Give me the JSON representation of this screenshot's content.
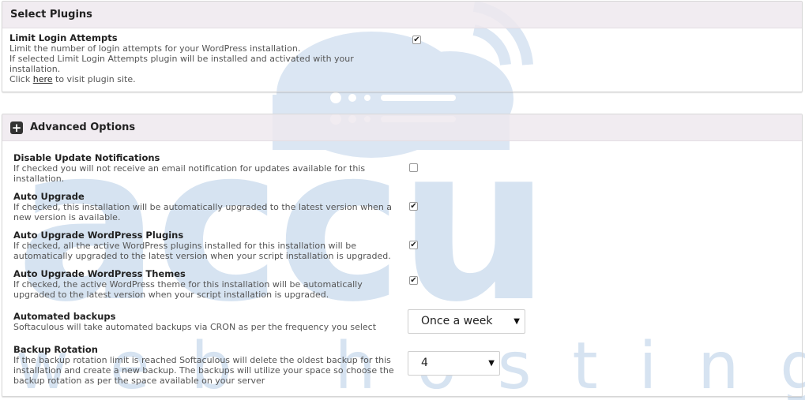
{
  "select_plugins": {
    "title": "Select Plugins",
    "limit_login": {
      "label": "Limit Login Attempts",
      "line1": "Limit the number of login attempts for your WordPress installation.",
      "line2": "If selected Limit Login Attempts plugin will be installed and activated with your installation.",
      "click_prefix": "Click ",
      "link_text": "here",
      "click_suffix": " to visit plugin site.",
      "checked": true
    }
  },
  "advanced": {
    "title": "Advanced Options",
    "expand_symbol": "+",
    "disable_update": {
      "label": "Disable Update Notifications",
      "desc": "If checked you will not receive an email notification for updates available for this installation.",
      "checked": false
    },
    "auto_upgrade": {
      "label": "Auto Upgrade",
      "desc": "If checked, this installation will be automatically upgraded to the latest version when a new version is available.",
      "checked": true
    },
    "auto_upgrade_plugins": {
      "label": "Auto Upgrade WordPress Plugins",
      "desc": "If checked, all the active WordPress plugins installed for this installation will be automatically upgraded to the latest version when your script installation is upgraded.",
      "checked": true
    },
    "auto_upgrade_themes": {
      "label": "Auto Upgrade WordPress Themes",
      "desc": "If checked, the active WordPress theme for this installation will be automatically upgraded to the latest version when your script installation is upgraded.",
      "checked": true
    },
    "automated_backups": {
      "label": "Automated backups",
      "desc": "Softaculous will take automated backups via CRON as per the frequency you select",
      "selected": "Once a week"
    },
    "backup_rotation": {
      "label": "Backup Rotation",
      "desc": "If the backup rotation limit is reached Softaculous will delete the oldest backup for this installation and create a new backup. The backups will utilize your space so choose the backup rotation as per the space available on your server",
      "selected": "4"
    }
  },
  "watermark": {
    "word1": "accu",
    "word2": "web hosting",
    "color": "#c9d9ec"
  },
  "check_mark": "✔",
  "dropdown_arrow": "▼"
}
